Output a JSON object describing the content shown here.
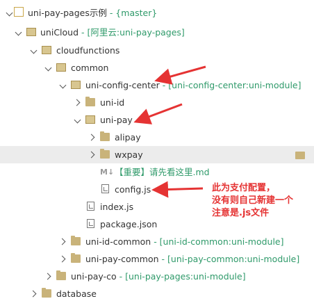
{
  "tree": {
    "project": {
      "name": "uni-pay-pages示例",
      "meta": "- {master}"
    },
    "unicloud": {
      "name": "uniCloud",
      "meta": "- [阿里云:uni-pay-pages]"
    },
    "cloudfunctions": {
      "name": "cloudfunctions"
    },
    "common": {
      "name": "common"
    },
    "config_center": {
      "name": "uni-config-center",
      "meta": "- [uni-config-center:uni-module]"
    },
    "uni_id": {
      "name": "uni-id"
    },
    "uni_pay": {
      "name": "uni-pay"
    },
    "alipay": {
      "name": "alipay"
    },
    "wxpay": {
      "name": "wxpay"
    },
    "readme": {
      "name": "【重要】请先看这里.md",
      "badge": "M↓"
    },
    "config_js": {
      "name": "config.js"
    },
    "index_js": {
      "name": "index.js"
    },
    "package_json": {
      "name": "package.json"
    },
    "uni_id_common": {
      "name": "uni-id-common",
      "meta": "- [uni-id-common:uni-module]"
    },
    "uni_pay_common": {
      "name": "uni-pay-common",
      "meta": "- [uni-pay-common:uni-module]"
    },
    "uni_pay_co": {
      "name": "uni-pay-co",
      "meta": "- [uni-pay-pages:uni-module]"
    },
    "database": {
      "name": "database"
    }
  },
  "annotation": {
    "lines": [
      "此为支付配置，",
      "没有则自己新建一个",
      "注意是.js文件"
    ],
    "color": "#e53333"
  },
  "colors": {
    "meta_green": "#2f9a6a",
    "folder": "#c9b37a",
    "selection": "#ececec"
  }
}
